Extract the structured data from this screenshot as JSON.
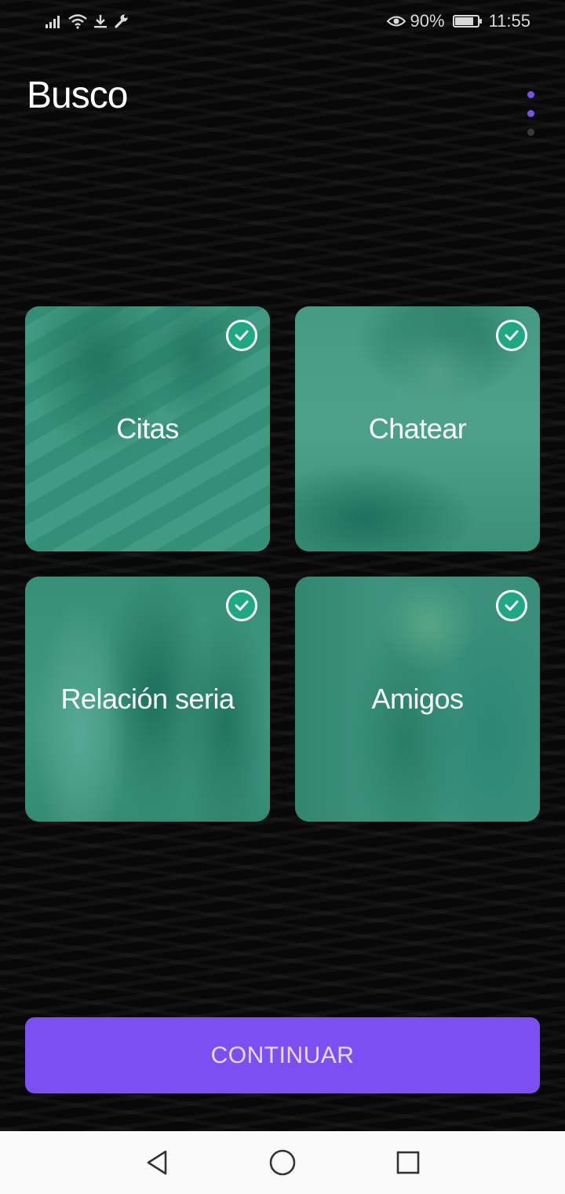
{
  "status_bar": {
    "battery": "90%",
    "battery_level": 0.9,
    "time": "11:55",
    "icons": [
      "signal-icon",
      "wifi-icon",
      "download-icon",
      "wrench-icon",
      "eye-icon",
      "battery-icon"
    ]
  },
  "header": {
    "title": "Busco",
    "steps_total": 3,
    "steps_active": 2
  },
  "options": [
    {
      "label": "Citas",
      "selected": true
    },
    {
      "label": "Chatear",
      "selected": true
    },
    {
      "label": "Relación seria",
      "selected": true
    },
    {
      "label": "Amigos",
      "selected": true
    }
  ],
  "continue_label": "CONTINUAR",
  "colors": {
    "accent": "#7b4ff2",
    "card_overlay": "#1f9274",
    "check": "#1fa884",
    "background": "#080808"
  },
  "nav_bar": {
    "icons": [
      "back-icon",
      "home-icon",
      "recents-icon"
    ]
  }
}
